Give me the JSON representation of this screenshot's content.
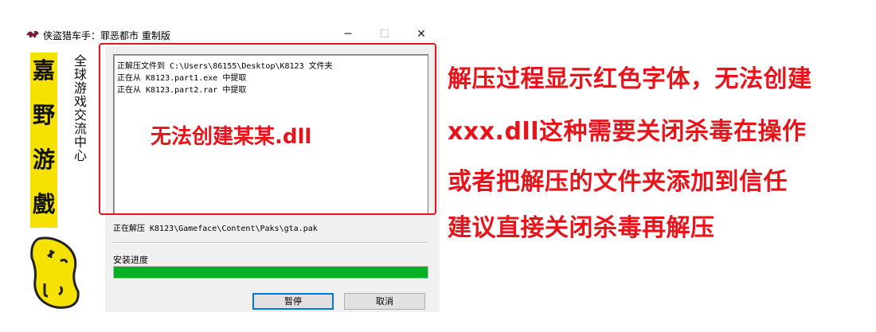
{
  "window": {
    "title": "侠盗猎车手：罪恶都市 重制版",
    "minimize_glyph": "─",
    "maximize_glyph": "☐",
    "close_glyph": "✕"
  },
  "sidebar": {
    "logo_chars": [
      "嘉",
      "野",
      "游",
      "戲"
    ],
    "slogan": "全球游戏交流中心",
    "logo_color": "#f6e200"
  },
  "log": {
    "lines": [
      "正解压文件到 C:\\Users\\86155\\Desktop\\K8123 文件夹",
      "正在从 K8123.part1.exe 中提取",
      "正在从 K8123.part2.rar 中提取"
    ],
    "overlay_text": "无法创建某某.dll"
  },
  "status": {
    "text": "正在解压 K8123\\Gameface\\Content\\Paks\\gta.pak"
  },
  "progress": {
    "label": "安装进度",
    "value_fraction": 1.0,
    "color": "#06b025"
  },
  "buttons": {
    "pause": "暂停",
    "cancel": "取消"
  },
  "annotation": {
    "color": "#e8141b",
    "lines": [
      "解压过程显示红色字体，无法创建",
      "xxx.dll这种需要关闭杀毒在操作",
      "或者把解压的文件夹添加到信任",
      "建议直接关闭杀毒再解压"
    ]
  }
}
